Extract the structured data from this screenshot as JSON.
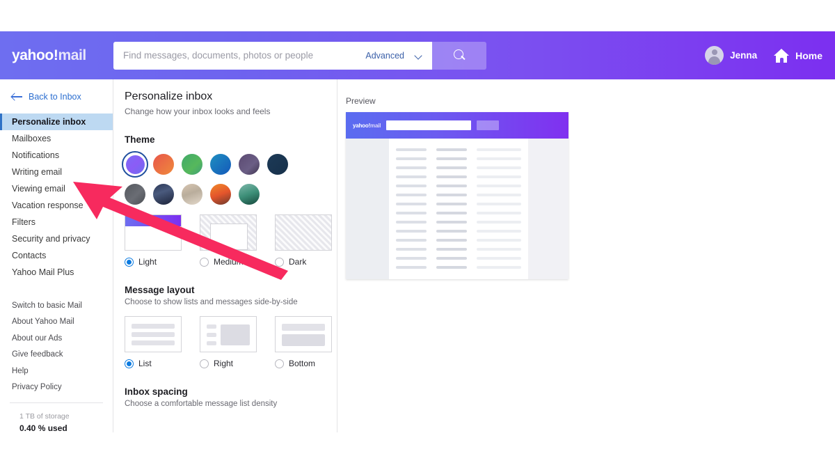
{
  "header": {
    "brand_yahoo": "yahoo",
    "brand_bang": "!",
    "brand_mail": "mail",
    "search_placeholder": "Find messages, documents, photos or people",
    "advanced_label": "Advanced",
    "search_icon": "search-icon",
    "chevron_icon": "chevron-down-icon",
    "user_name": "Jenna",
    "home_label": "Home",
    "gradient_start": "#6e6ef0",
    "gradient_end": "#7c2ff0"
  },
  "sidebar": {
    "back_label": "Back to Inbox",
    "back_icon": "arrow-left-icon",
    "items": [
      {
        "label": "Personalize inbox",
        "active": true
      },
      {
        "label": "Mailboxes",
        "active": false
      },
      {
        "label": "Notifications",
        "active": false
      },
      {
        "label": "Writing email",
        "active": false
      },
      {
        "label": "Viewing email",
        "active": false
      },
      {
        "label": "Vacation response",
        "active": false
      },
      {
        "label": "Filters",
        "active": false
      },
      {
        "label": "Security and privacy",
        "active": false
      },
      {
        "label": "Contacts",
        "active": false
      },
      {
        "label": "Yahoo Mail Plus",
        "active": false
      }
    ],
    "secondary_items": [
      {
        "label": "Switch to basic Mail"
      },
      {
        "label": "About Yahoo Mail"
      },
      {
        "label": "About our Ads"
      },
      {
        "label": "Give feedback"
      },
      {
        "label": "Help"
      },
      {
        "label": "Privacy Policy"
      }
    ],
    "storage_total": "1 TB of storage",
    "storage_used": "0.40 % used",
    "active_bg": "#bdd9f2"
  },
  "settings": {
    "page_title": "Personalize inbox",
    "page_subtitle": "Change how your inbox looks and feels",
    "theme": {
      "title": "Theme",
      "swatches_row1": [
        {
          "name": "theme-swatch-purple",
          "selected": true,
          "css": "linear-gradient(135deg,#7b6bf5 0%,#8b5cf6 50%,#6d6df0 100%)"
        },
        {
          "name": "theme-swatch-sunset",
          "selected": false,
          "css": "linear-gradient(135deg,#e8564a 0%,#ef8a3c 100%)"
        },
        {
          "name": "theme-swatch-green",
          "selected": false,
          "css": "linear-gradient(135deg,#41a96a 0%,#56b85c 60%,#3f9f7a 100%)"
        },
        {
          "name": "theme-swatch-teal",
          "selected": false,
          "css": "linear-gradient(135deg,#1f8fc0 0%,#1459ba 100%)"
        },
        {
          "name": "theme-swatch-plum",
          "selected": false,
          "css": "linear-gradient(135deg,#5b4a72 0%,#6b5e85 60%,#3f3550 100%)"
        },
        {
          "name": "theme-swatch-navy",
          "selected": false,
          "css": "linear-gradient(135deg,#1d3a57 0%,#16304a 100%)"
        }
      ],
      "swatches_row2": [
        {
          "name": "theme-swatch-photo-gray",
          "css": "linear-gradient(135deg,#55585e 0%,#6a6d74 55%,#4b4e54 100%)"
        },
        {
          "name": "theme-swatch-photo-night",
          "css": "linear-gradient(160deg,#2b3757 0%,#4a5a7d 40%,#1b2238 100%)"
        },
        {
          "name": "theme-swatch-photo-sand",
          "css": "linear-gradient(160deg,#d8c6b2 0%,#b9ad9c 45%,#e4d9cb 100%)"
        },
        {
          "name": "theme-swatch-photo-sunset",
          "css": "linear-gradient(160deg,#f08a2a 0%,#e4552c 50%,#6b3a2c 100%)"
        },
        {
          "name": "theme-swatch-photo-forest",
          "css": "linear-gradient(160deg,#7fb8ab 0%,#3d8f78 50%,#16473c 100%)"
        }
      ],
      "density_options": [
        {
          "label": "Light",
          "selected": true
        },
        {
          "label": "Medium",
          "selected": false
        },
        {
          "label": "Dark",
          "selected": false
        }
      ]
    },
    "message_layout": {
      "title": "Message layout",
      "subtitle": "Choose to show lists and messages side-by-side",
      "options": [
        {
          "label": "List",
          "selected": true
        },
        {
          "label": "Right",
          "selected": false
        },
        {
          "label": "Bottom",
          "selected": false
        }
      ]
    },
    "inbox_spacing": {
      "title": "Inbox spacing",
      "subtitle": "Choose a comfortable message list density"
    }
  },
  "preview": {
    "label": "Preview",
    "mini_brand_yahoo": "yahoo",
    "mini_brand_bang": "!",
    "mini_brand_mail": "mail"
  },
  "annotation": {
    "arrow_color": "#f72a5e",
    "arrow_name": "pointer-arrow-annotation",
    "points_to": "Viewing email"
  }
}
